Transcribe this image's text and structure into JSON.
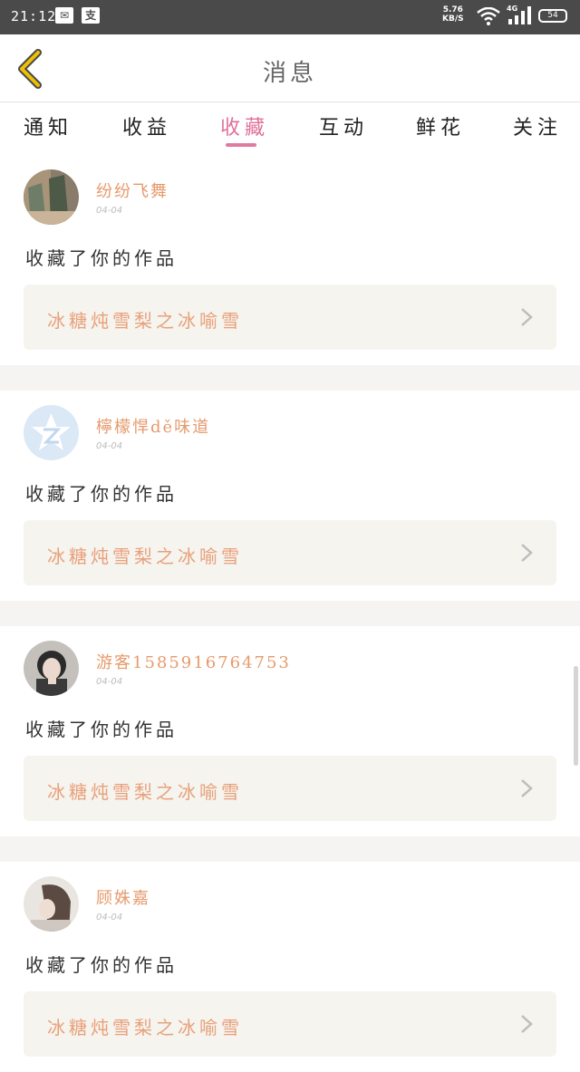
{
  "status_bar": {
    "time": "21:12",
    "speed_value": "5.76",
    "speed_unit": "KB/S",
    "network": "4G",
    "battery": "54"
  },
  "header": {
    "title": "消息"
  },
  "tabs": [
    {
      "label": "通知"
    },
    {
      "label": "收益"
    },
    {
      "label": "收藏",
      "active": true
    },
    {
      "label": "互动"
    },
    {
      "label": "鲜花"
    },
    {
      "label": "关注"
    }
  ],
  "items": [
    {
      "user": "纷纷飞舞",
      "date": "04-04",
      "action": "收藏了你的作品",
      "work": "冰糖炖雪梨之冰喻雪"
    },
    {
      "user": "檸檬悍dě味道",
      "date": "04-04",
      "action": "收藏了你的作品",
      "work": "冰糖炖雪梨之冰喻雪"
    },
    {
      "user": "游客1585916764753",
      "date": "04-04",
      "action": "收藏了你的作品",
      "work": "冰糖炖雪梨之冰喻雪"
    },
    {
      "user": "顾姝嘉",
      "date": "04-04",
      "action": "收藏了你的作品",
      "work": "冰糖炖雪梨之冰喻雪"
    }
  ],
  "colors": {
    "accent": "#e0709a",
    "username": "#e69a6c",
    "work_title": "#e9a07a",
    "back_icon": "#f0c000"
  }
}
